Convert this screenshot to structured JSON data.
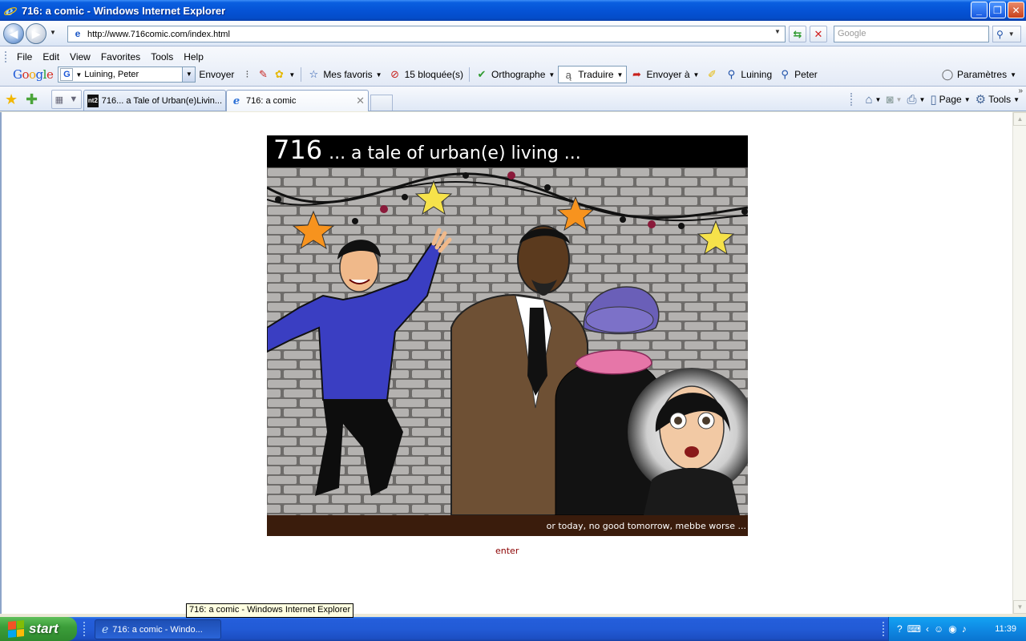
{
  "window": {
    "title": "716: a comic - Windows Internet Explorer",
    "controls": {
      "minimize": "_",
      "maximize": "❐",
      "close": "✕"
    }
  },
  "address_bar": {
    "url": "http://www.716comic.com/index.html",
    "search_placeholder": "Google"
  },
  "menu": {
    "items": [
      "File",
      "Edit",
      "View",
      "Favorites",
      "Tools",
      "Help"
    ]
  },
  "google_toolbar": {
    "logo": "Google",
    "search_value": "Luining, Peter",
    "envoyer": "Envoyer",
    "mes_favoris": "Mes favoris",
    "bloquees": "15 bloquée(s)",
    "orthographe": "Orthographe",
    "traduire": "Traduire",
    "envoyer_a": "Envoyer à",
    "luining": "Luining",
    "peter": "Peter",
    "parametres": "Paramètres"
  },
  "tabs": [
    {
      "label": "716... a Tale of Urban(e)Livin...",
      "favicon": "nt2",
      "active": false
    },
    {
      "label": "716: a comic",
      "favicon": "ie",
      "active": true
    }
  ],
  "command_bar": {
    "page": "Page",
    "tools": "Tools"
  },
  "page": {
    "banner_number": "716",
    "banner_tagline": "... a tale of urban(e) living ...",
    "caption": "or today, no good tomorrow, mebbe worse ...",
    "enter_link": "enter"
  },
  "tooltip": "716: a comic - Windows Internet Explorer",
  "taskbar": {
    "start": "start",
    "task_item": "716: a comic - Windo...",
    "clock": "11:39"
  },
  "colors": {
    "titlebar": "#0553d6",
    "enter_link": "#8b0000",
    "banner_header": "#000000",
    "taskbar": "#225bd6",
    "start_button": "#3c9e3a"
  }
}
